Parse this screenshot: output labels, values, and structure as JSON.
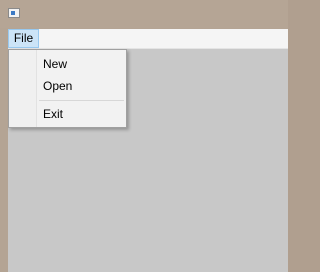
{
  "window": {
    "icon": "app-window-icon"
  },
  "menubar": {
    "items": [
      {
        "label": "File"
      }
    ]
  },
  "file_menu": {
    "items": [
      {
        "label": "New"
      },
      {
        "label": "Open"
      },
      {
        "label": "Exit"
      }
    ]
  },
  "colors": {
    "titlebar": "#b5a595",
    "menubar": "#f5f5f5",
    "menu_highlight": "#cce4f7",
    "client": "#c8c8c8",
    "dropdown": "#f2f2f2"
  }
}
